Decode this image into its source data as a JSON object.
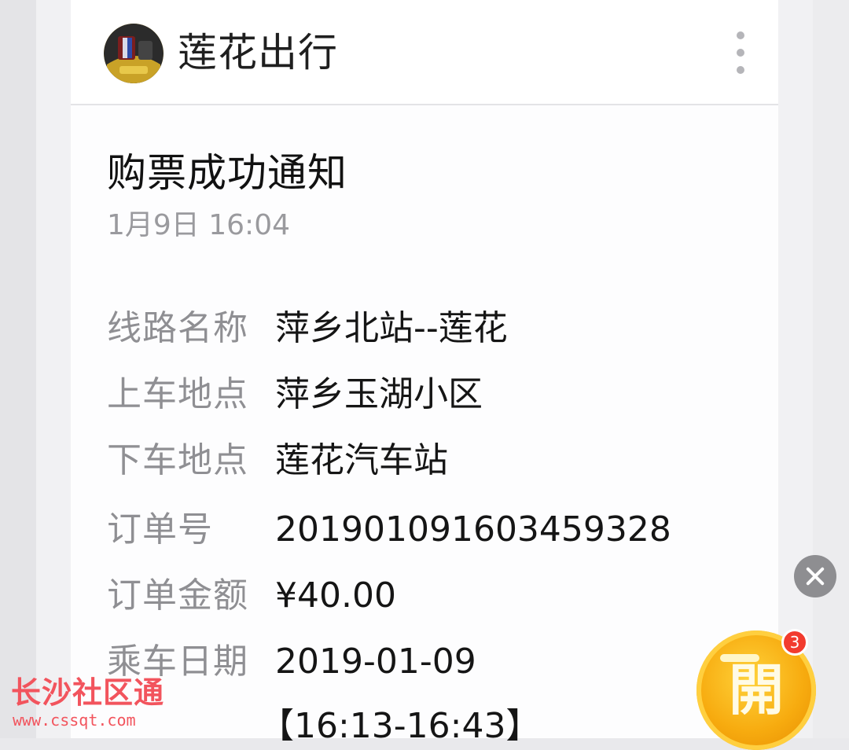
{
  "header": {
    "account_name": "莲花出行"
  },
  "message": {
    "title": "购票成功通知",
    "time": "1月9日  16:04",
    "fields": [
      {
        "label": "线路名称",
        "value": "萍乡北站--莲花"
      },
      {
        "label": "上车地点",
        "value": "萍乡玉湖小区"
      },
      {
        "label": "下车地点",
        "value": "莲花汽车站"
      },
      {
        "label": "订单号",
        "value": "201901091603459328"
      },
      {
        "label": "订单金额",
        "value": "¥40.00"
      },
      {
        "label": "乘车日期",
        "value": "2019-01-09",
        "value_line2": "【16:13-16:43】"
      }
    ]
  },
  "floating": {
    "open_label": "開",
    "badge_count": "3"
  },
  "watermark": {
    "title": "长沙社区通",
    "url": "www.cssqt.com"
  }
}
